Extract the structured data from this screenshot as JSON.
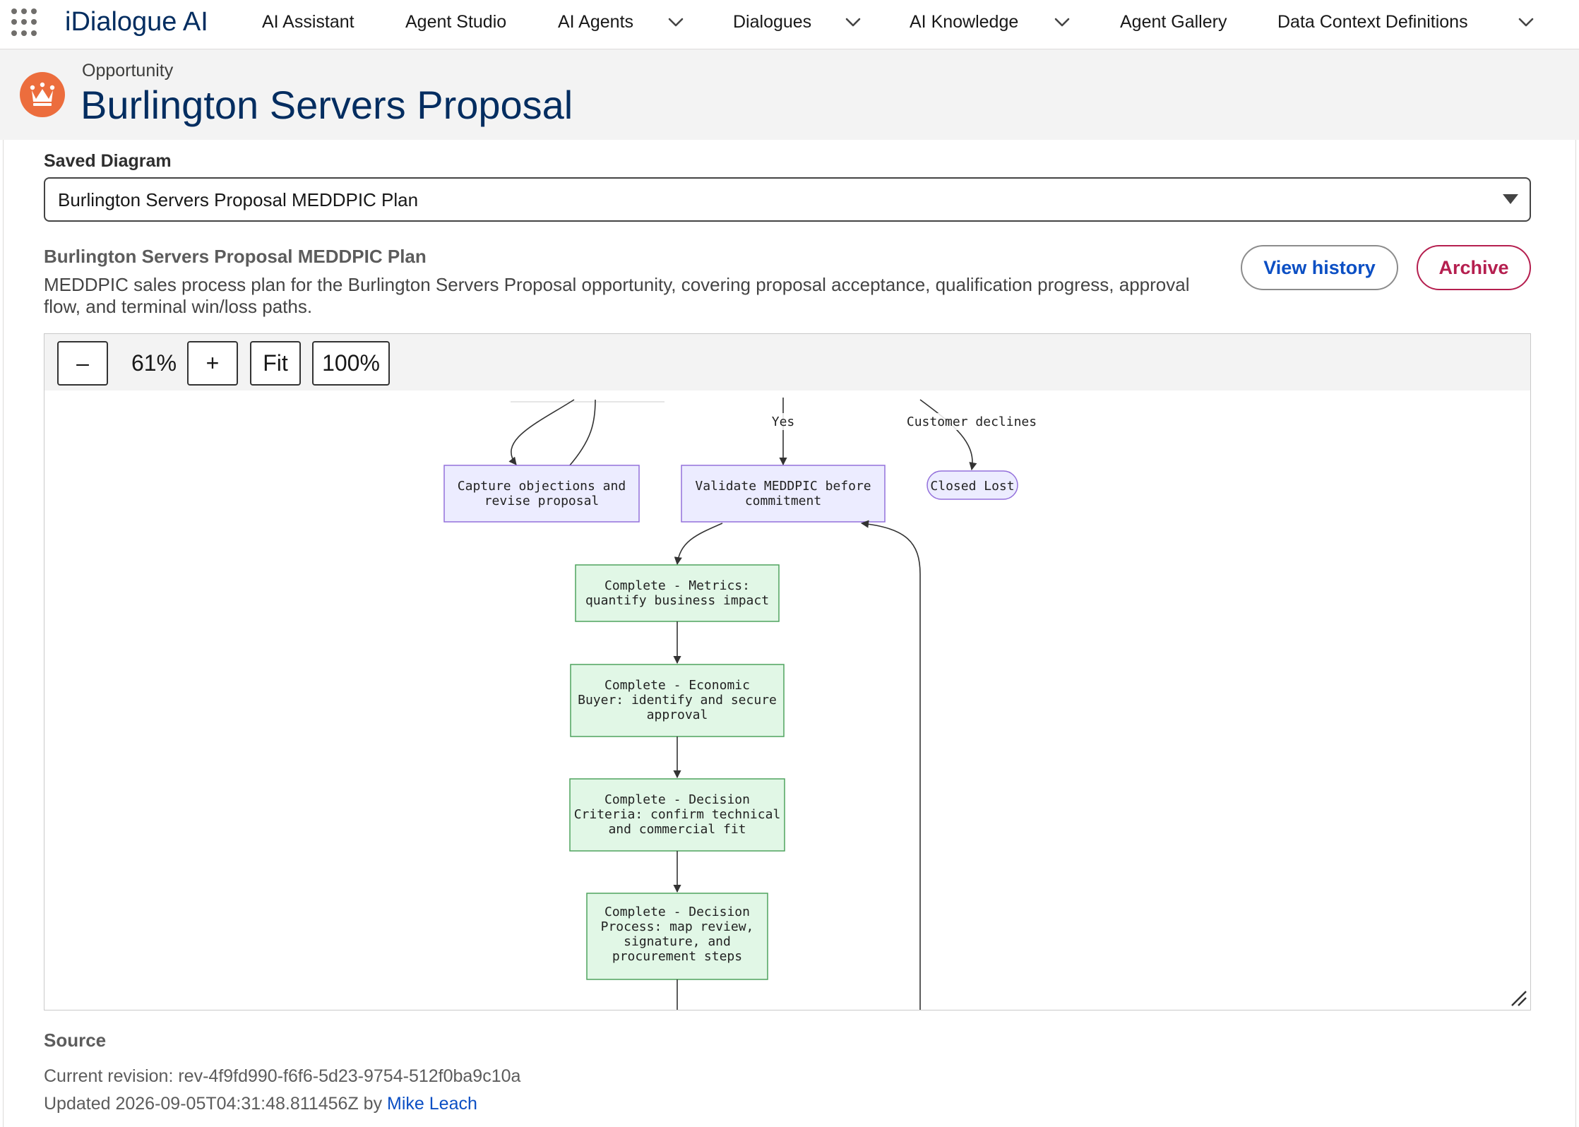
{
  "app": {
    "name": "iDialogue AI"
  },
  "nav": {
    "items": [
      {
        "label": "AI Assistant",
        "has_menu": false
      },
      {
        "label": "Agent Studio",
        "has_menu": false
      },
      {
        "label": "AI Agents",
        "has_menu": true
      },
      {
        "label": "Dialogues",
        "has_menu": true
      },
      {
        "label": "AI Knowledge",
        "has_menu": true
      },
      {
        "label": "Agent Gallery",
        "has_menu": false
      },
      {
        "label": "Data Context Definitions",
        "has_menu": true
      }
    ]
  },
  "record": {
    "object_type": "Opportunity",
    "title": "Burlington Servers Proposal",
    "icon": "crown-icon",
    "icon_color": "#ec6d3d"
  },
  "saved_diagram": {
    "label": "Saved Diagram",
    "selected": "Burlington Servers Proposal MEDDPIC Plan"
  },
  "diagram": {
    "title": "Burlington Servers Proposal MEDDPIC Plan",
    "description": "MEDDPIC sales process plan for the Burlington Servers Proposal opportunity, covering proposal acceptance, qualification progress, approval flow, and terminal win/loss paths.",
    "view_history_label": "View history",
    "archive_label": "Archive",
    "toolbar": {
      "zoom_out_label": "–",
      "zoom_level": "61%",
      "zoom_in_label": "+",
      "fit_label": "Fit",
      "reset_label": "100%"
    },
    "nodes": {
      "capture": [
        "Capture objections and",
        "revise proposal"
      ],
      "validate": [
        "Validate MEDDPIC before",
        "commitment"
      ],
      "closed_lost": [
        "Closed Lost"
      ],
      "metrics": [
        "Complete - Metrics:",
        "quantify business impact"
      ],
      "economic": [
        "Complete - Economic",
        "Buyer: identify and secure",
        "approval"
      ],
      "criteria": [
        "Complete - Decision",
        "Criteria: confirm technical",
        "and commercial fit"
      ],
      "process": [
        "Complete - Decision",
        "Process: map review,",
        "signature, and",
        "procurement steps"
      ]
    },
    "edges": {
      "yes_label": "Yes",
      "declines_label": "Customer declines"
    },
    "colors": {
      "purple_fill": "#ececff",
      "purple_stroke": "#9370db",
      "green_fill": "#e1f7e6",
      "green_stroke": "#4fa35f"
    }
  },
  "source": {
    "label": "Source",
    "revision": "Current revision: rev-4f9fd990-f6f6-5d23-9754-512f0ba9c10a",
    "updated_prefix": "Updated 2026-09-05T04:31:48.811456Z by",
    "updated_by": "Mike Leach"
  }
}
